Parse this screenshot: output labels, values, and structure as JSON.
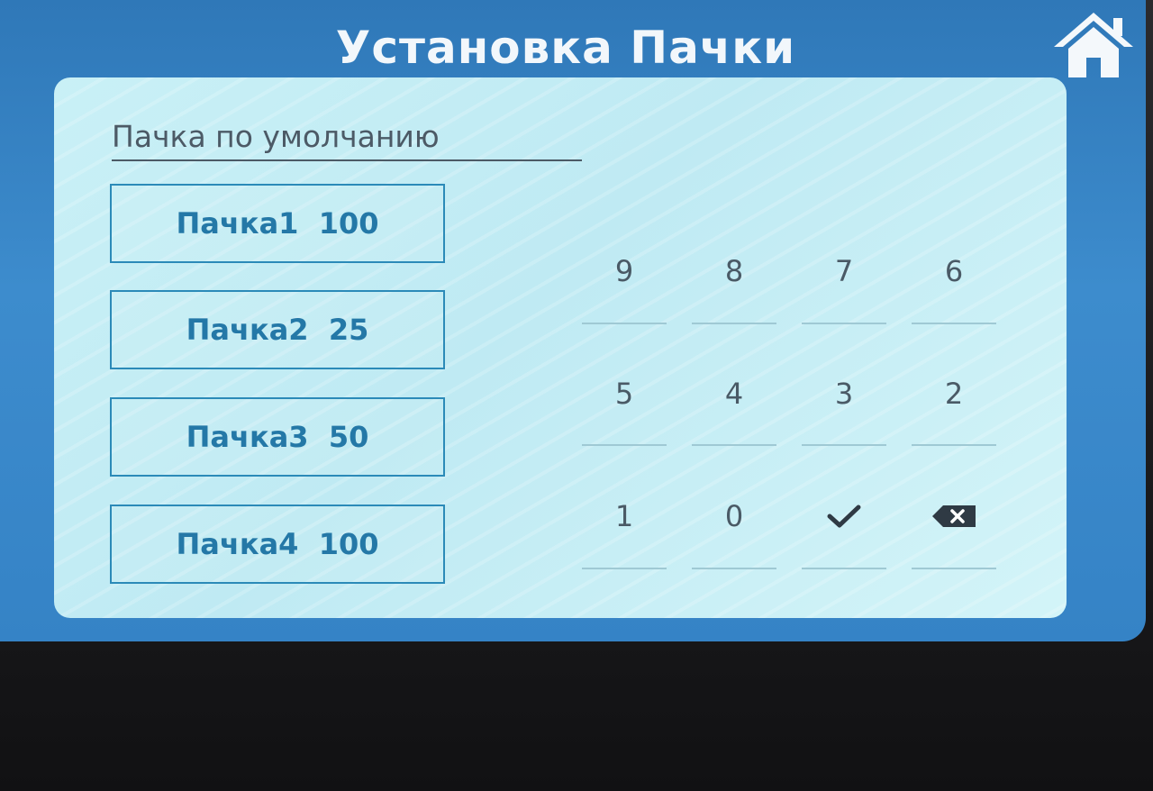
{
  "screen": {
    "title": "Установка Пачки",
    "home_icon": "home-icon"
  },
  "default_batch": {
    "label": "Пачка по умолчанию"
  },
  "batches": [
    {
      "label": "Пачка1  100"
    },
    {
      "label": "Пачка2  25"
    },
    {
      "label": "Пачка3  50"
    },
    {
      "label": "Пачка4  100"
    }
  ],
  "keypad": {
    "row1": [
      "9",
      "8",
      "7",
      "6"
    ],
    "row2": [
      "5",
      "4",
      "3",
      "2"
    ],
    "row3": [
      "1",
      "0"
    ],
    "confirm_icon": "checkmark-icon",
    "backspace_icon": "backspace-icon"
  },
  "colors": {
    "screen_blue": "#3583c6",
    "panel_bg": "#c9f0f6",
    "button_border": "#2b8ab8",
    "button_text": "#2478a7",
    "key_text": "#4a5a66"
  }
}
